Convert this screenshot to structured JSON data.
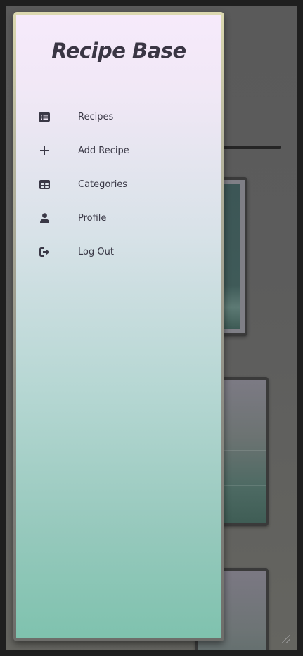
{
  "drawer": {
    "title": "Recipe Base",
    "items": [
      {
        "label": "Recipes",
        "icon": "list-icon"
      },
      {
        "label": "Add Recipe",
        "icon": "plus-icon"
      },
      {
        "label": "Categories",
        "icon": "table-icon"
      },
      {
        "label": "Profile",
        "icon": "user-icon"
      },
      {
        "label": "Log Out",
        "icon": "sign-out-icon"
      }
    ]
  },
  "colors": {
    "drawer_gradient_top": "#f6eafb",
    "drawer_gradient_bottom": "#7fc2ae",
    "text": "#3a3846"
  }
}
